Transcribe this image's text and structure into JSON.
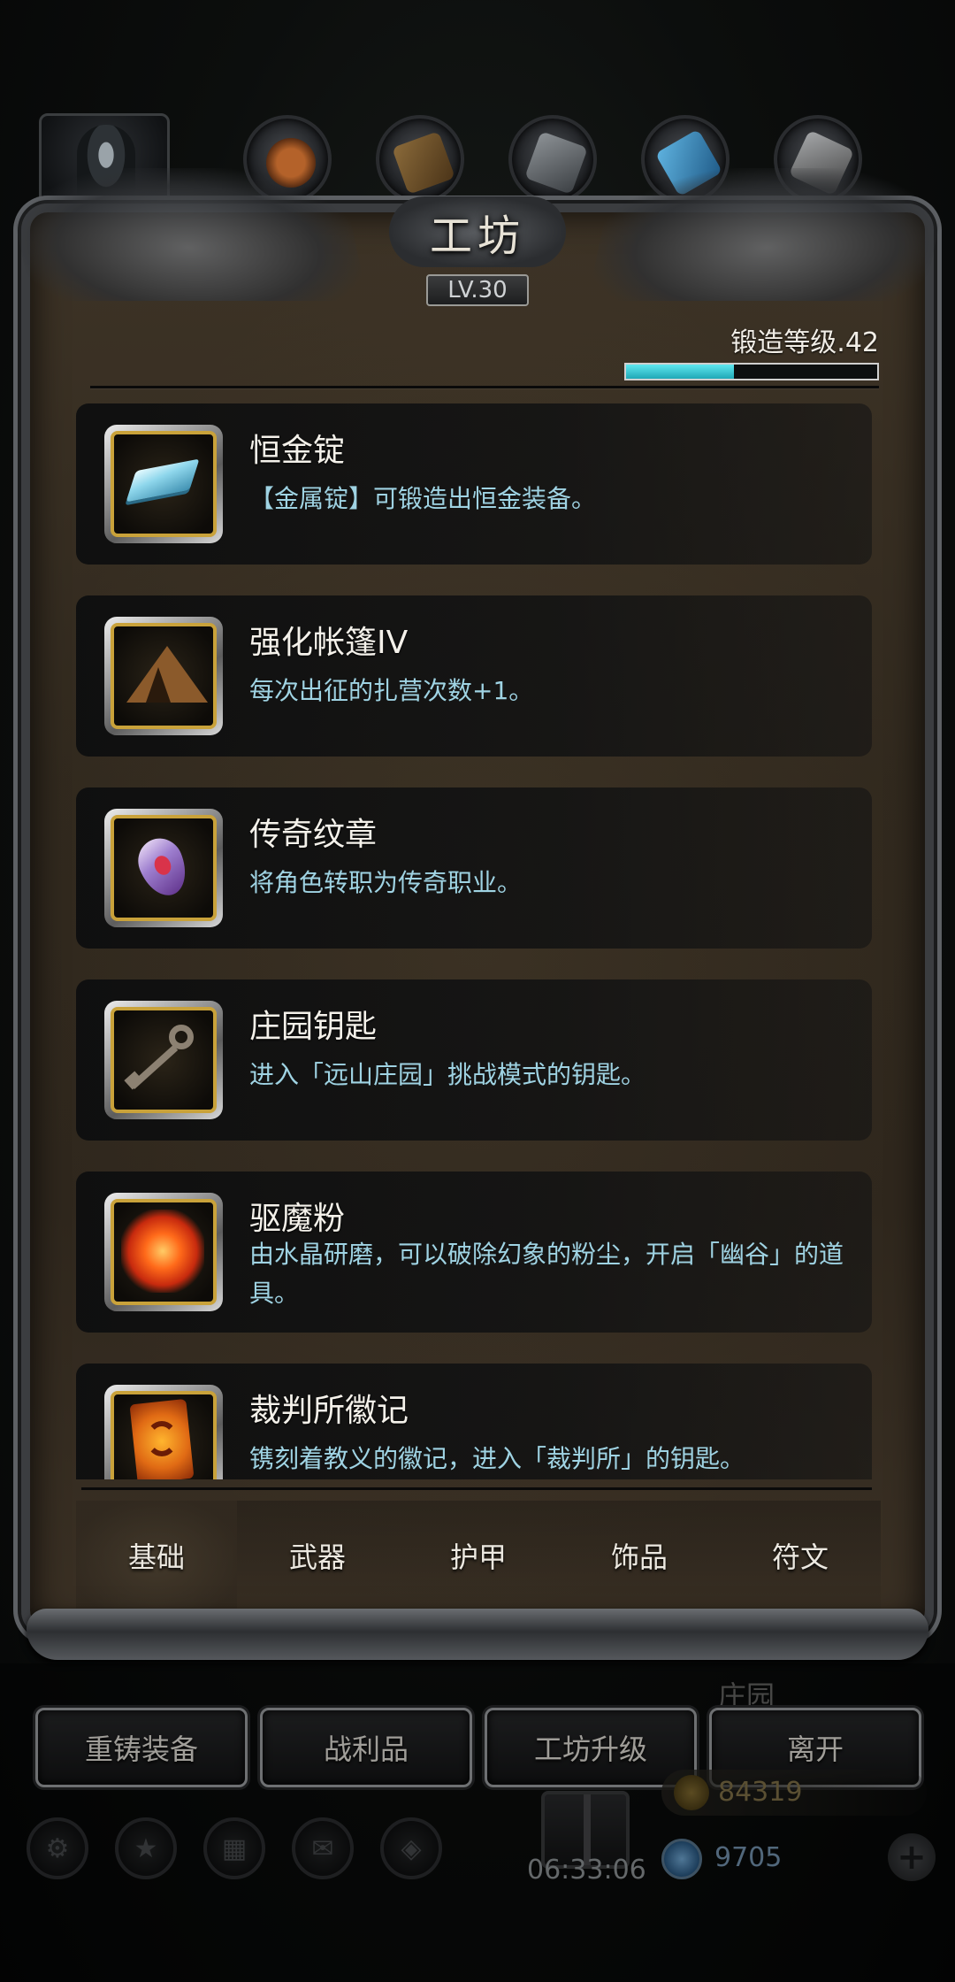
{
  "title": "工坊",
  "level": "LV.30",
  "forge": {
    "label": "锻造等级.42",
    "progress": 0.43,
    "color": "#3fd0dc"
  },
  "items": [
    {
      "name": "恒金锭",
      "desc": "【金属锭】可锻造出恒金装备。",
      "icon": "ingot-icon"
    },
    {
      "name": "强化帐篷IV",
      "desc": "每次出征的扎营次数+1。",
      "icon": "tent-icon"
    },
    {
      "name": "传奇纹章",
      "desc": "将角色转职为传奇职业。",
      "icon": "emblem-icon"
    },
    {
      "name": "庄园钥匙",
      "desc": "进入「远山庄园」挑战模式的钥匙。",
      "icon": "key-icon"
    },
    {
      "name": "驱魔粉",
      "desc": "由水晶研磨，可以破除幻象的粉尘，开启「幽谷」的道具。",
      "icon": "powder-icon"
    },
    {
      "name": "裁判所徽记",
      "desc": "镌刻着教义的徽记，进入「裁判所」的钥匙。",
      "icon": "seal-icon"
    }
  ],
  "categories": [
    "基础",
    "武器",
    "护甲",
    "饰品",
    "符文"
  ],
  "active_category": "基础",
  "actions": [
    "重铸装备",
    "战利品",
    "工坊升级",
    "离开"
  ],
  "hud": {
    "manor_label": "庄园",
    "gold": "84319",
    "gems": "9705",
    "timer": "06:33:06"
  },
  "colors": {
    "accent_cyan": "#3fd0dc",
    "item_desc": "#9fd3e3",
    "icon_frame_gold": "#c9a23a"
  }
}
